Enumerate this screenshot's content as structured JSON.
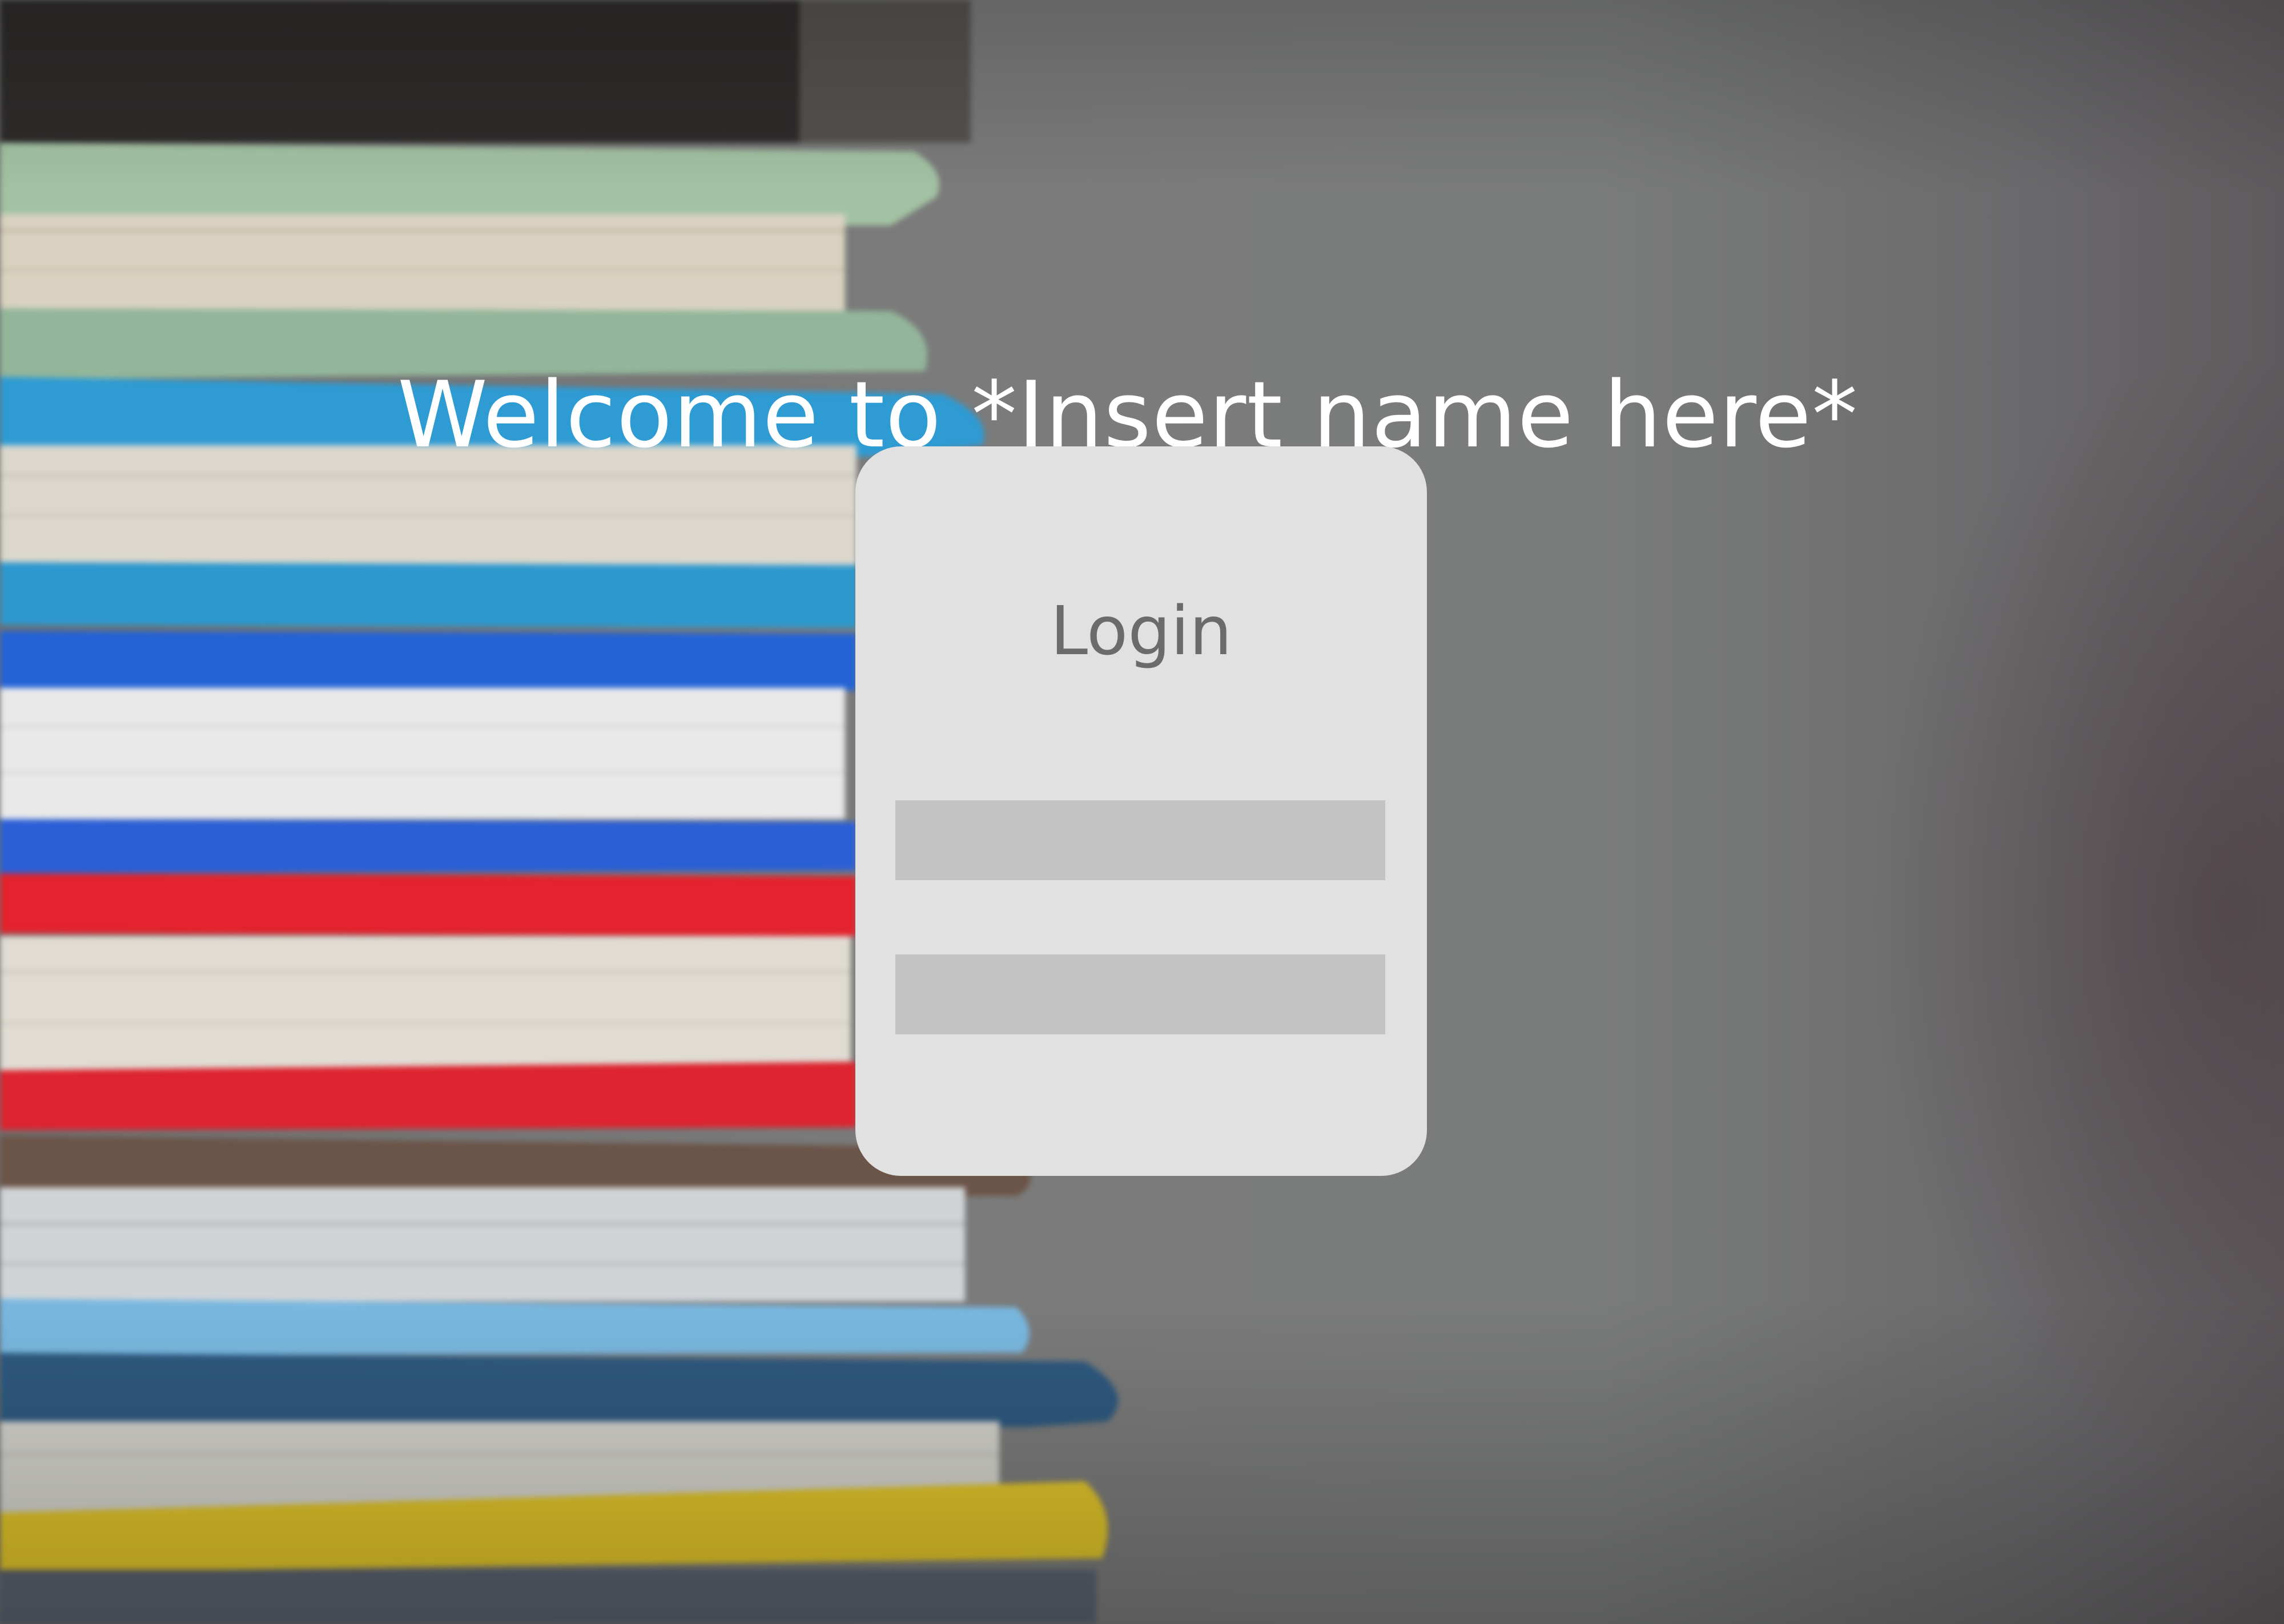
{
  "page": {
    "welcome_title": "Welcome to *Insert name here*"
  },
  "login": {
    "heading": "Login",
    "username": {
      "value": "",
      "placeholder": ""
    },
    "password": {
      "value": "",
      "placeholder": ""
    }
  },
  "background": {
    "image": "blurred-stack-of-books-photo"
  },
  "colors": {
    "card_background": "#e1e1e1",
    "input_background": "#c3c3c3",
    "heading_text": "#6b6b6b",
    "title_text": "#ffffff"
  }
}
